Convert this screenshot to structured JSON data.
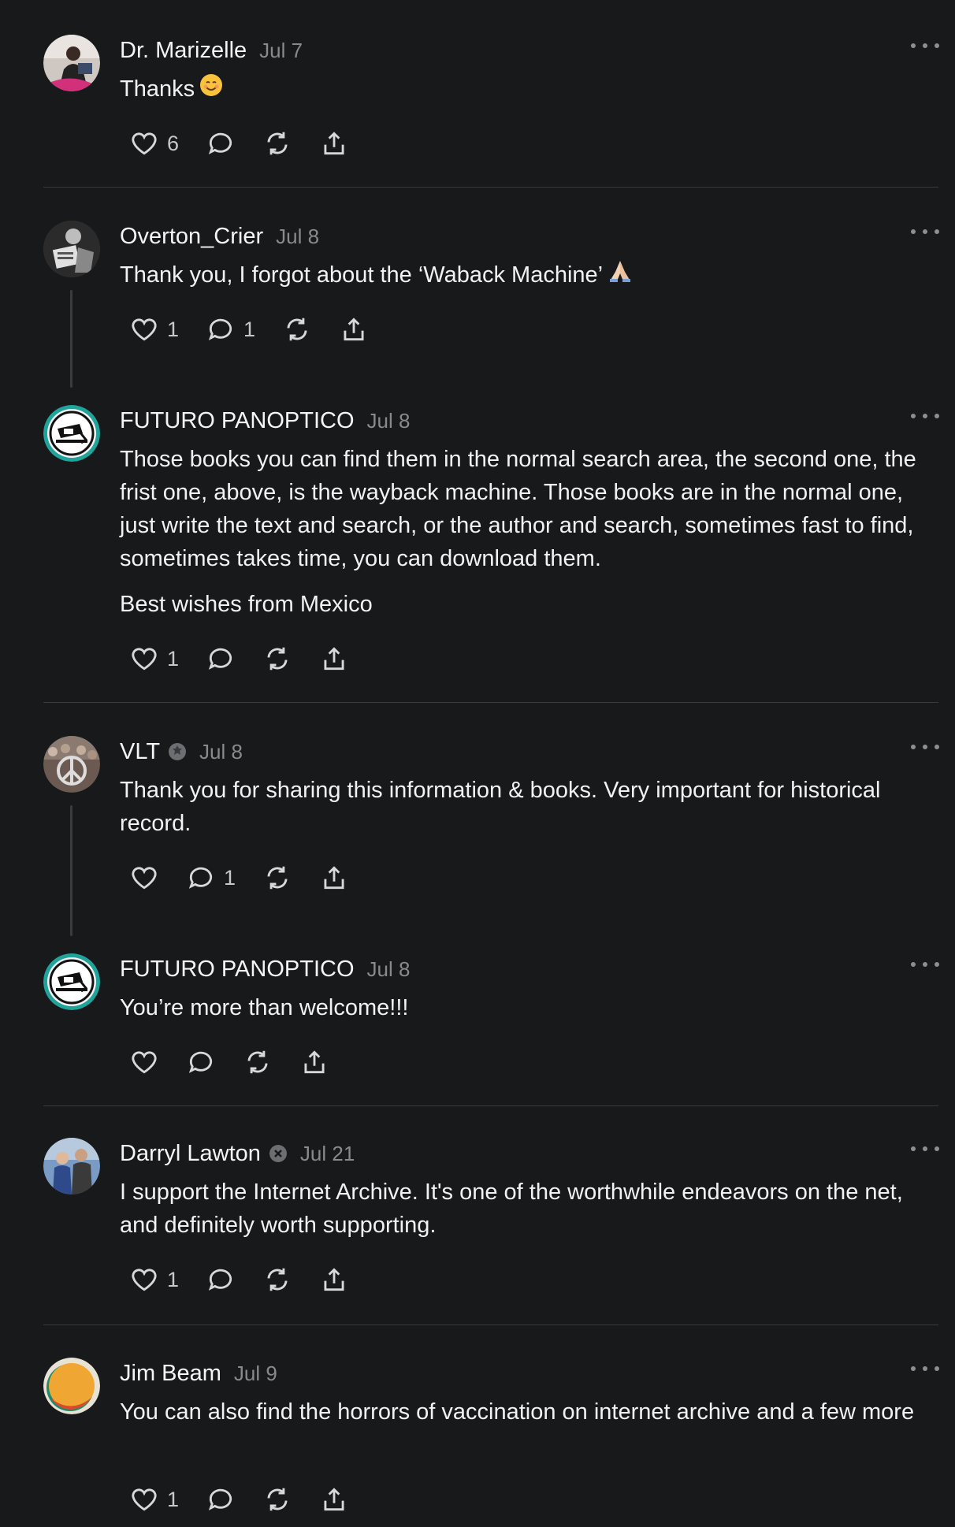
{
  "posts": [
    {
      "author": "Dr. Marizelle",
      "date": "Jul 7",
      "text": [
        "Thanks"
      ],
      "emoji": "smile",
      "likes": "6",
      "replies": "",
      "verified": false
    },
    {
      "author": "Overton_Crier",
      "date": "Jul 8",
      "text": [
        "Thank you, I forgot about the ‘Waback Machine’"
      ],
      "emoji": "pray",
      "likes": "1",
      "replies": "1",
      "verified": false
    },
    {
      "author": "FUTURO PANOPTICO",
      "date": "Jul 8",
      "text": [
        "Those books you can find them in the normal search area, the second one, the frist one, above, is the wayback machine. Those books are in the normal one, just write the text and search, or the author and search, sometimes fast to find, sometimes takes time, you can download them.",
        "Best wishes from Mexico"
      ],
      "likes": "1",
      "replies": "",
      "verified": false
    },
    {
      "author": "VLT",
      "date": "Jul 8",
      "text": [
        "Thank you for sharing this information & books. Very important for historical record."
      ],
      "likes": "",
      "replies": "1",
      "verified": true
    },
    {
      "author": "FUTURO PANOPTICO",
      "date": "Jul 8",
      "text": [
        "You’re more than welcome!!!"
      ],
      "likes": "",
      "replies": "",
      "verified": false
    },
    {
      "author": "Darryl Lawton",
      "date": "Jul 21",
      "text": [
        "I support the Internet Archive. It's one of the worthwhile endeavors on the net, and definitely worth supporting."
      ],
      "likes": "1",
      "replies": "",
      "verified": true
    },
    {
      "author": "Jim Beam",
      "date": "Jul 9",
      "text": [
        "You can also find the horrors of vaccination on internet archive and a few more"
      ],
      "likes": "1",
      "replies": "",
      "verified": false
    }
  ],
  "icons": {
    "like": "heart-icon",
    "reply": "comment-icon",
    "repost": "repost-icon",
    "share": "share-icon",
    "more": "more-icon",
    "verified": "verified-badge-icon"
  },
  "colors": {
    "background": "#18191b",
    "text": "#f2f2f2",
    "muted": "#8a8a8e",
    "divider": "#3a3a3c",
    "teal": "#1fa39a"
  }
}
